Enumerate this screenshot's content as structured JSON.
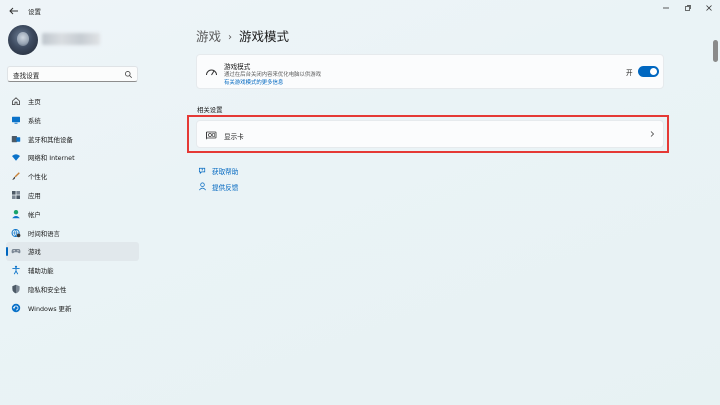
{
  "window": {
    "title": "设置"
  },
  "search": {
    "placeholder": "查找设置"
  },
  "nav": {
    "items": [
      {
        "label": "主页",
        "icon": "home-icon"
      },
      {
        "label": "系统",
        "icon": "system-icon"
      },
      {
        "label": "蓝牙和其他设备",
        "icon": "bluetooth-icon"
      },
      {
        "label": "网络和 Internet",
        "icon": "wifi-icon"
      },
      {
        "label": "个性化",
        "icon": "brush-icon"
      },
      {
        "label": "应用",
        "icon": "apps-icon"
      },
      {
        "label": "帐户",
        "icon": "account-icon"
      },
      {
        "label": "时间和语言",
        "icon": "globe-clock-icon"
      },
      {
        "label": "游戏",
        "icon": "gamepad-icon",
        "selected": true
      },
      {
        "label": "辅助功能",
        "icon": "accessibility-icon"
      },
      {
        "label": "隐私和安全性",
        "icon": "shield-icon"
      },
      {
        "label": "Windows 更新",
        "icon": "update-icon"
      }
    ]
  },
  "breadcrumb": {
    "parent": "游戏",
    "current": "游戏模式"
  },
  "game_mode": {
    "title": "游戏模式",
    "description": "通过在后台关闭内容来优化电脑以供游戏",
    "link": "有关游戏模式的更多信息",
    "toggle_state": "开",
    "toggle_on": true
  },
  "related": {
    "heading": "相关设置",
    "graphics_label": "显示卡"
  },
  "links": {
    "help": "获取帮助",
    "feedback": "提供反馈"
  },
  "colors": {
    "accent": "#0067c0",
    "highlight": "#e53935"
  }
}
